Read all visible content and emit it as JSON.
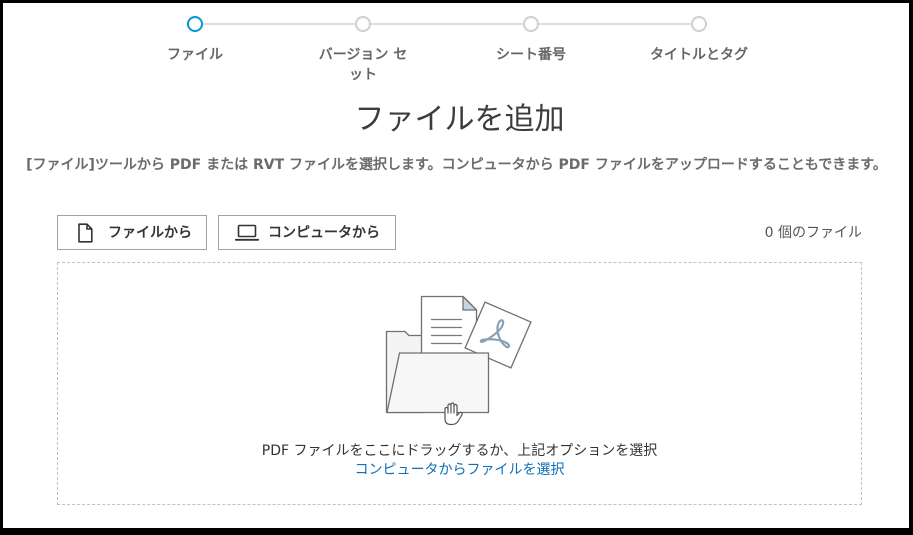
{
  "stepper": {
    "steps": [
      {
        "label": "ファイル",
        "current": true
      },
      {
        "label": "バージョン セット",
        "current": false
      },
      {
        "label": "シート番号",
        "current": false
      },
      {
        "label": "タイトルとタグ",
        "current": false
      }
    ]
  },
  "main": {
    "title": "ファイルを追加",
    "description": "[ファイル]ツールから PDF または RVT ファイルを選択します。コンピュータから PDF ファイルをアップロードすることもできます。"
  },
  "toolbar": {
    "from_files": {
      "label": "ファイルから",
      "icon": "file-icon"
    },
    "from_computer": {
      "label": "コンピュータから",
      "icon": "laptop-icon"
    },
    "file_count": "0 個のファイル"
  },
  "dropzone": {
    "illustration_icon": "folder-with-pdf-icon",
    "cursor_icon": "hand-grab-icon",
    "instruction": "PDF ファイルをここにドラッグするか、上記オプションを選択",
    "select_link": "コンピュータからファイルを選択"
  },
  "colors": {
    "accent": "#0696d7",
    "step_inactive": "#cfcfcf",
    "link": "#0c72b8",
    "title_text": "#3c3c3c"
  }
}
